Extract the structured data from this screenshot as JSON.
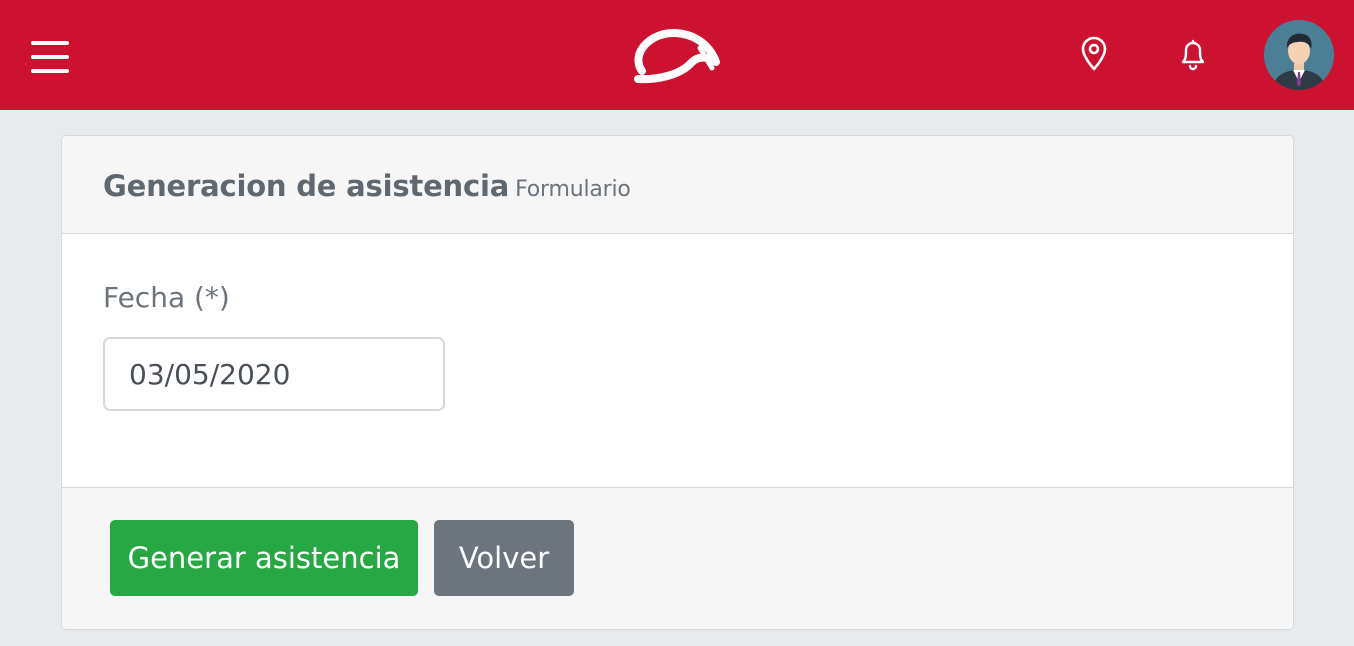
{
  "topbar": {
    "menu_icon": "hamburger-menu-icon",
    "logo_icon": "brand-logo-icon",
    "location_icon": "map-pin-icon",
    "notifications_icon": "bell-icon",
    "avatar_icon": "user-avatar",
    "background_color": "#cc1230"
  },
  "card": {
    "title": "Generacion de asistencia",
    "subtitle": "Formulario"
  },
  "form": {
    "date_label": "Fecha (*)",
    "date_value": "03/05/2020"
  },
  "actions": {
    "generate_label": "Generar asistencia",
    "generate_color": "#28a745",
    "back_label": "Volver",
    "back_color": "#6c757d"
  }
}
